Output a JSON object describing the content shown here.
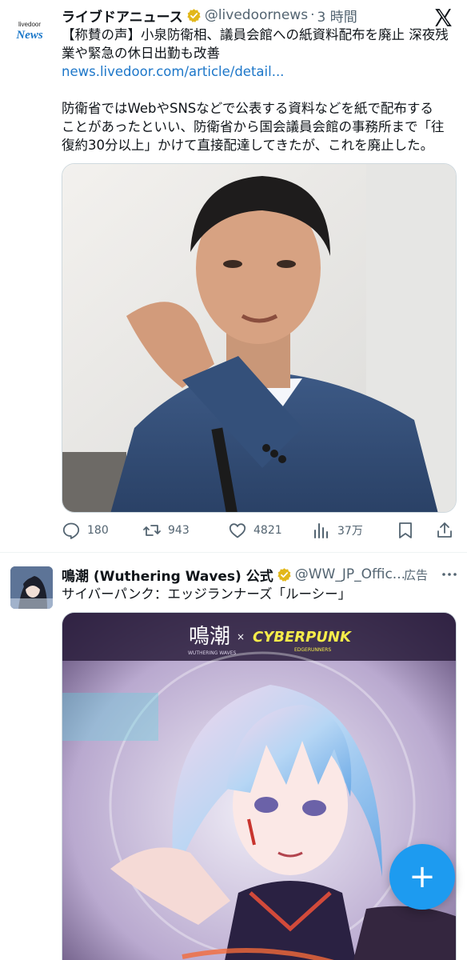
{
  "tweet1": {
    "avatar": {
      "top_text": "livedoor",
      "brand_text": "News"
    },
    "author_name": "ライブドアニュース",
    "handle": "@livedoornews",
    "separator": "·",
    "time": "3 時間",
    "text_line1": "【称賛の声】小泉防衛相、議員会館への紙資料配布を廃止 深夜残",
    "text_line2": "業や緊急の休日出勤も改善",
    "link": "news.livedoor.com/article/detail...",
    "para_line1": "防衛省ではWebやSNSなどで公表する資料などを紙で配布する",
    "para_line2": "ことがあったといい、防衛省から国会議員会館の事務所まで「往",
    "para_line3": "復約30分以上」かけて直接配達してきたが、これを廃止した。",
    "actions": {
      "replies": "180",
      "reposts": "943",
      "likes": "4821",
      "views": "37万"
    }
  },
  "tweet2": {
    "author_name": "鳴潮 (Wuthering Waves) 公式",
    "handle": "@WW_JP_Offic...",
    "ad_label": "広告",
    "text": "サイバーパンク：エッジランナーズ「ルーシー」",
    "media_logo_left": "鳴潮",
    "media_logo_sub": "WUTHERING WAVES",
    "media_logo_x": "×",
    "media_logo_right": "CYBERPUNK",
    "media_logo_right_sub": "EDGERUNNERS"
  },
  "fab": {
    "label": "+"
  },
  "colors": {
    "accent": "#1d9bf0",
    "link": "#1d77c9",
    "muted": "#536471",
    "verified": "#e2b719"
  }
}
